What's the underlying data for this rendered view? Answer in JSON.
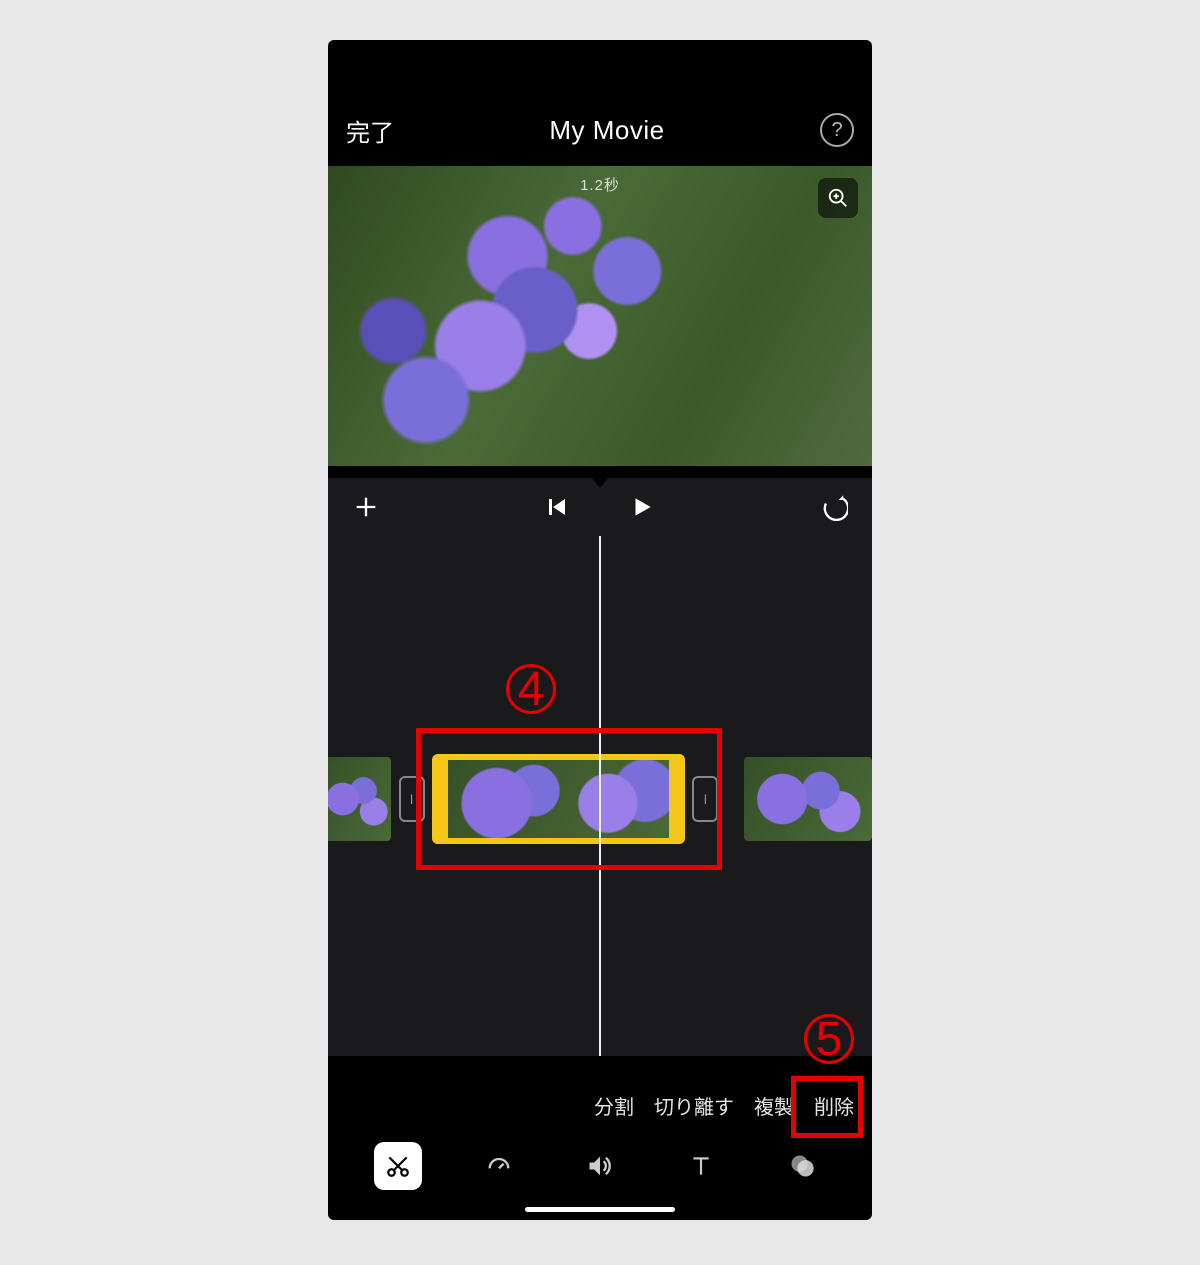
{
  "header": {
    "done_label": "完了",
    "title": "My Movie",
    "help_glyph": "?"
  },
  "preview": {
    "time_label": "1.2秒"
  },
  "actions": {
    "split": "分割",
    "detach": "切り離す",
    "duplicate": "複製",
    "delete": "削除"
  },
  "annotations": {
    "step4": "4",
    "step5": "5"
  },
  "icons": {
    "add": "add-icon",
    "prev": "prev-icon",
    "play": "play-icon",
    "undo": "undo-icon",
    "zoom": "zoom-icon",
    "cut": "cut-icon",
    "speed": "speed-icon",
    "volume": "volume-icon",
    "text": "text-icon",
    "filter": "filter-icon"
  }
}
